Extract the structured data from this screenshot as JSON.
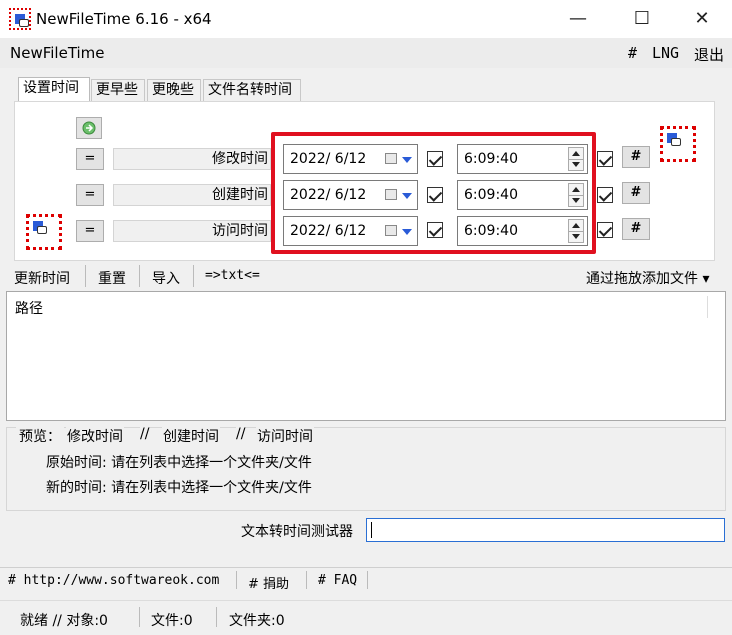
{
  "window": {
    "title": "NewFileTime 6.16 - x64",
    "minimize": "—",
    "maximize": "☐",
    "close": "✕"
  },
  "menubar": {
    "app_name": "NewFileTime",
    "hash": "#",
    "lng": "LNG",
    "exit": "退出"
  },
  "tabs": [
    {
      "label": "设置时间"
    },
    {
      "label": "更早些"
    },
    {
      "label": "更晚些"
    },
    {
      "label": "文件名转时间"
    }
  ],
  "rows": [
    {
      "eq": "=",
      "label": "修改时间",
      "date": "2022/  6/12",
      "time": "6:09:40",
      "hash": "#"
    },
    {
      "eq": "=",
      "label": "创建时间",
      "date": "2022/  6/12",
      "time": "6:09:40",
      "hash": "#"
    },
    {
      "eq": "=",
      "label": "访问时间",
      "date": "2022/  6/12",
      "time": "6:09:40",
      "hash": "#"
    }
  ],
  "toolbar": {
    "update_time": "更新时间",
    "reset": "重置",
    "import": "导入",
    "txt": "=>txt<=",
    "drag_add": "通过拖放添加文件 ▾"
  },
  "list": {
    "column_path": "路径"
  },
  "preview": {
    "label": "预览：",
    "modified": "修改时间",
    "sep1": "//",
    "created": "创建时间",
    "sep2": "//",
    "accessed": "访问时间",
    "original": "原始时间: 请在列表中选择一个文件夹/文件",
    "new": "新的时间: 请在列表中选择一个文件夹/文件"
  },
  "tester": {
    "label": "文本转时间测试器",
    "value": ""
  },
  "links": {
    "website": "# http://www.softwareok.com",
    "donate": "# 捐助",
    "faq": "# FAQ"
  },
  "status": {
    "ready": "就绪 // 对象:0",
    "files": "文件:0",
    "folders": "文件夹:0"
  },
  "colors": {
    "highlight_box": "#e0101f",
    "icon_blue": "#2a5bd7"
  }
}
